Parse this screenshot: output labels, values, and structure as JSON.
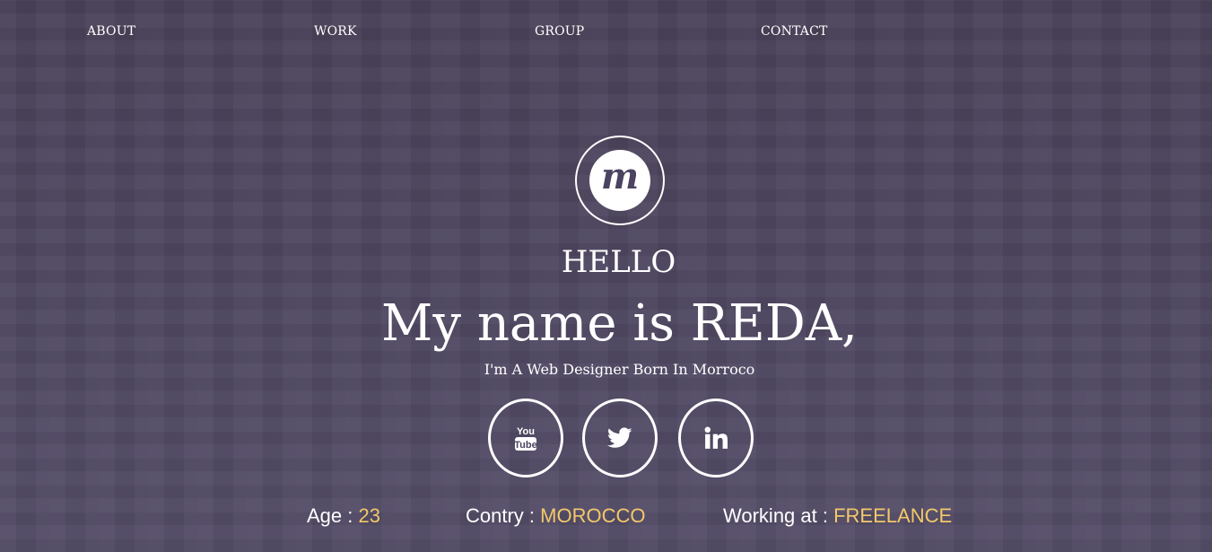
{
  "nav": {
    "items": [
      {
        "label": "ABOUT"
      },
      {
        "label": "WORK"
      },
      {
        "label": "GROUP"
      },
      {
        "label": "CONTACT"
      }
    ]
  },
  "logo": {
    "letter": "m",
    "icon": "m-logo-icon"
  },
  "hero": {
    "greeting": "HELLO",
    "headline": "My name is REDA,",
    "tagline": "I'm A Web Designer Born In Morroco"
  },
  "social": [
    {
      "icon": "youtube-icon"
    },
    {
      "icon": "twitter-icon"
    },
    {
      "icon": "linkedin-icon"
    }
  ],
  "info": {
    "age_label": "Age :",
    "age_value": "23",
    "country_label": "Contry :",
    "country_value": "MOROCCO",
    "work_label": "Working at :",
    "work_value": "FREELANCE"
  },
  "colors": {
    "background": "#4b4360",
    "accent": "#f3c86a",
    "text": "#ffffff"
  }
}
